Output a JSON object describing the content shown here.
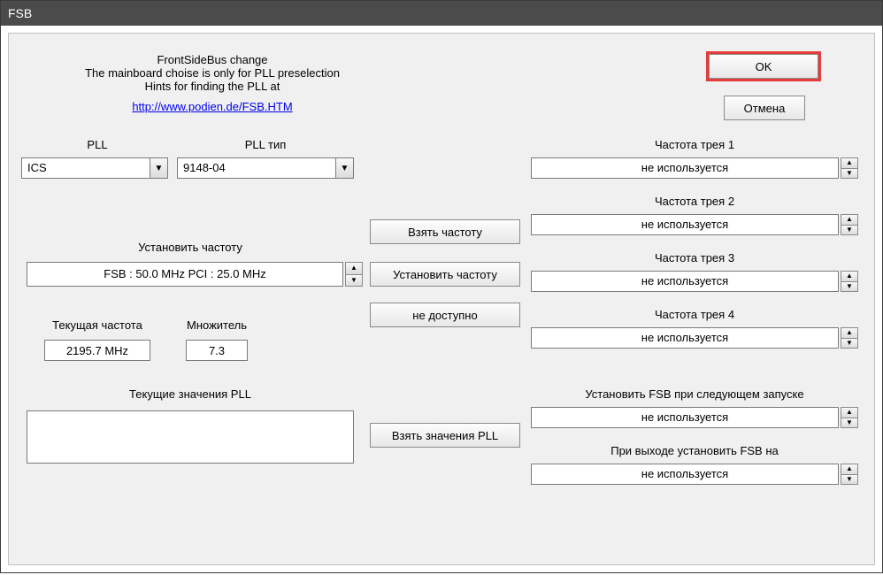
{
  "window": {
    "title": "FSB"
  },
  "header": {
    "line1": "FrontSideBus change",
    "line2": "The mainboard choise is only for PLL preselection",
    "line3": "Hints for finding the PLL at",
    "link": "http://www.podien.de/FSB.HTM"
  },
  "buttons": {
    "ok": "OK",
    "cancel": "Отмена",
    "take_freq": "Взять частоту",
    "set_freq": "Установить частоту",
    "not_available": "не доступно",
    "take_pll": "Взять значения PLL"
  },
  "pll": {
    "label": "PLL",
    "value": "ICS",
    "type_label": "PLL тип",
    "type_value": "9148-04"
  },
  "freq": {
    "set_label": "Установить частоту",
    "set_value": "FSB :  50.0 MHz  PCI :  25.0 MHz",
    "current_label": "Текущая частота",
    "current_value": "2195.7 MHz",
    "mult_label": "Множитель",
    "mult_value": "7.3",
    "pll_vals_label": "Текущие значения PLL"
  },
  "tray": {
    "not_used": "не используется",
    "f1": "Частота трея 1",
    "f2": "Частота трея 2",
    "f3": "Частота трея 3",
    "f4": "Частота трея 4",
    "set_next": "Установить FSB при следующем запуске",
    "on_exit": "При выходе установить FSB на"
  }
}
